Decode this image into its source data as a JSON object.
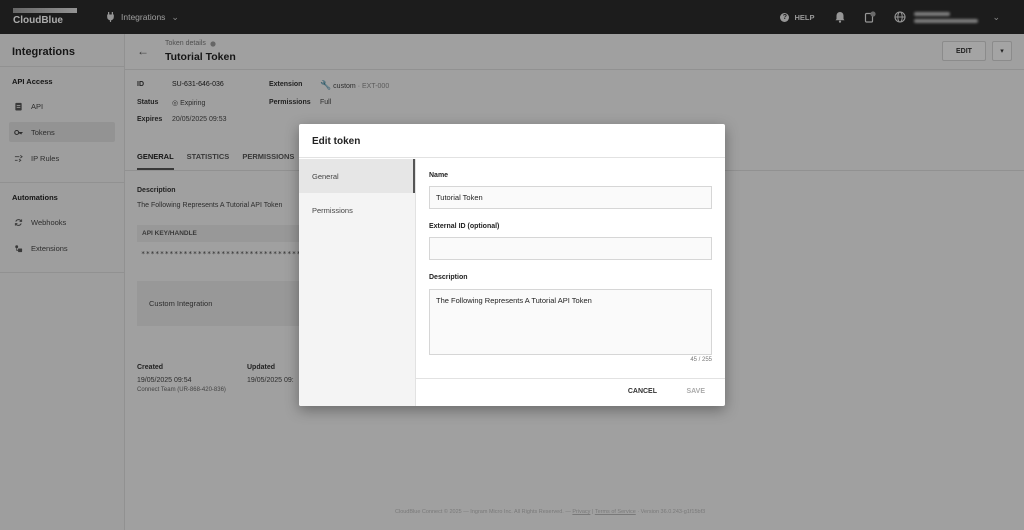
{
  "topbar": {
    "logo": "CloudBlue",
    "module": "Integrations",
    "help": "HELP",
    "icons": [
      "plug-icon",
      "chevron-down-icon",
      "help-icon",
      "bell-icon",
      "notification-icon",
      "globe-icon"
    ]
  },
  "sidebar": {
    "title": "Integrations",
    "sections": [
      {
        "title": "API Access",
        "items": [
          {
            "label": "API",
            "icon": "clipboard-icon"
          },
          {
            "label": "Tokens",
            "icon": "key-icon",
            "active": true
          },
          {
            "label": "IP Rules",
            "icon": "rules-icon"
          }
        ]
      },
      {
        "title": "Automations",
        "items": [
          {
            "label": "Webhooks",
            "icon": "sync-icon"
          },
          {
            "label": "Extensions",
            "icon": "extension-icon"
          }
        ]
      }
    ]
  },
  "header": {
    "breadcrumb": "Token details",
    "title": "Tutorial Token",
    "edit": "EDIT"
  },
  "details": {
    "id_label": "ID",
    "id_value": "SU-631-646-036",
    "status_label": "Status",
    "status_value": "Expiring",
    "expires_label": "Expires",
    "expires_value": "20/05/2025 09:53",
    "extension_label": "Extension",
    "extension_value": "custom",
    "extension_id": "EXT-000",
    "permissions_label": "Permissions",
    "permissions_value": "Full"
  },
  "tabs": [
    "GENERAL",
    "STATISTICS",
    "PERMISSIONS"
  ],
  "general": {
    "description_label": "Description",
    "description_value": "The Following Represents A Tutorial API Token",
    "api_key_label": "API KEY/HANDLE",
    "api_key_value": "****************************************",
    "integration_type": "Custom Integration",
    "created_label": "Created",
    "created_date": "19/05/2025 09:54",
    "created_by": "Connect Team (UR-868-420-836)",
    "updated_label": "Updated",
    "updated_date": "19/05/2025 09:"
  },
  "footer": {
    "copyright": "CloudBlue Connect © 2025 — Ingram Micro Inc. All Rights Reserved. —",
    "privacy": "Privacy",
    "terms": "Terms of Service",
    "version": "· Version 36.0.243-g1f15bf3"
  },
  "dialog": {
    "title": "Edit token",
    "nav": [
      "General",
      "Permissions"
    ],
    "name_label": "Name",
    "name_value": "Tutorial Token",
    "external_id_label": "External ID (optional)",
    "external_id_value": "",
    "description_label": "Description",
    "description_value": "The Following Represents A Tutorial API Token",
    "counter": "45 / 255",
    "cancel": "CANCEL",
    "save": "SAVE"
  }
}
